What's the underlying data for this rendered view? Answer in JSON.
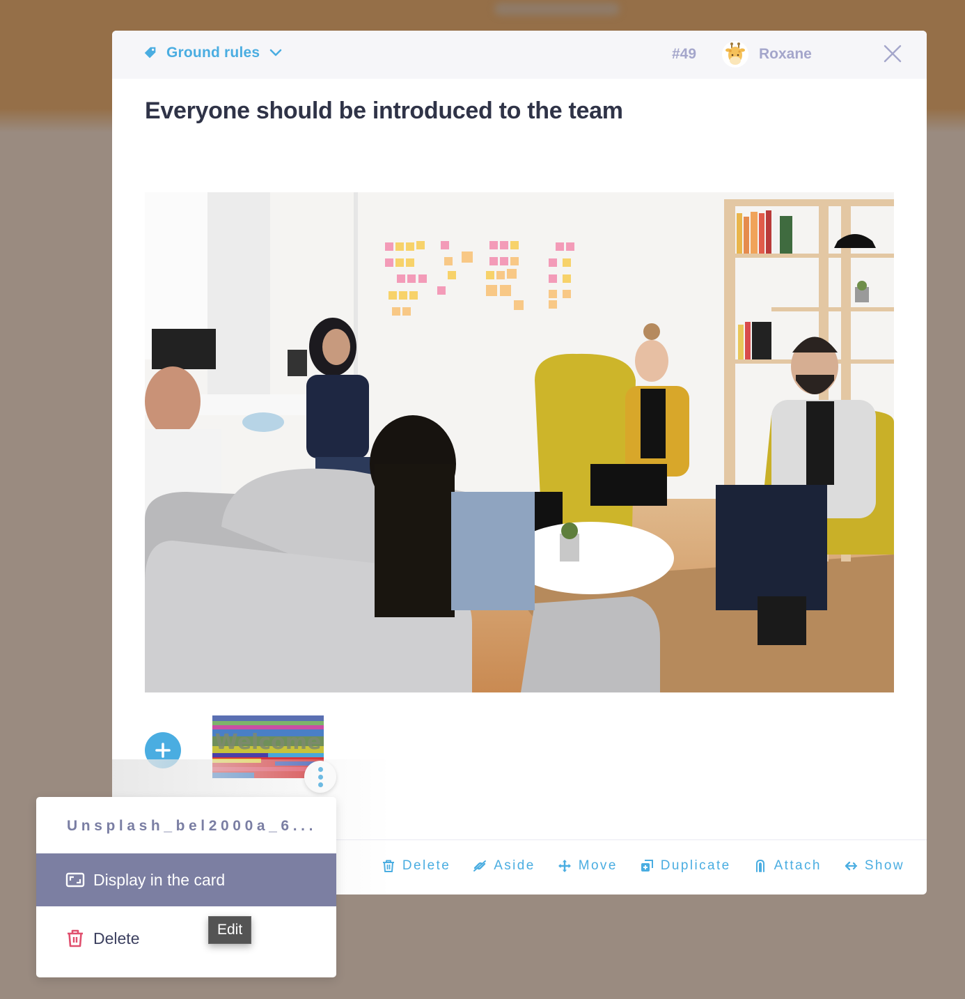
{
  "background": {
    "blurred_header_text": ""
  },
  "card": {
    "category": {
      "label": "Ground rules",
      "icon": "tag-icon"
    },
    "number": "#49",
    "author": {
      "name": "Roxane",
      "avatar": "giraffe-avatar"
    },
    "title": "Everyone should be introduced to the team",
    "cover_image": {
      "alt": "Team meeting in an office lounge",
      "description": "photo"
    },
    "attachments": [
      {
        "thumbnail_text": "Welcome",
        "name": "Unsplash_bel2000a_6..."
      }
    ],
    "actions": [
      {
        "label": "Delete",
        "icon": "trash-icon"
      },
      {
        "label": "Aside",
        "icon": "aside-icon"
      },
      {
        "label": "Move",
        "icon": "move-icon"
      },
      {
        "label": "Duplicate",
        "icon": "duplicate-icon"
      },
      {
        "label": "Attach",
        "icon": "paperclip-icon"
      },
      {
        "label": "Show",
        "icon": "show-icon"
      }
    ]
  },
  "attachment_menu": {
    "title": "Unsplash_bel2000a_6...",
    "items": [
      {
        "label": "Display in the card",
        "icon": "image-frame-icon",
        "active": true
      },
      {
        "label": "Delete",
        "icon": "trash-icon",
        "active": false
      }
    ]
  },
  "tooltip": {
    "text": "Edit"
  },
  "colors": {
    "accent": "#4aade1",
    "header_bg": "#f6f6f9",
    "muted": "#a4a6cb",
    "title": "#2f3347",
    "menu_active": "#7c7fa2",
    "danger": "#e0506e",
    "overlay_top": "#956f48",
    "overlay": "#9a8b80"
  }
}
